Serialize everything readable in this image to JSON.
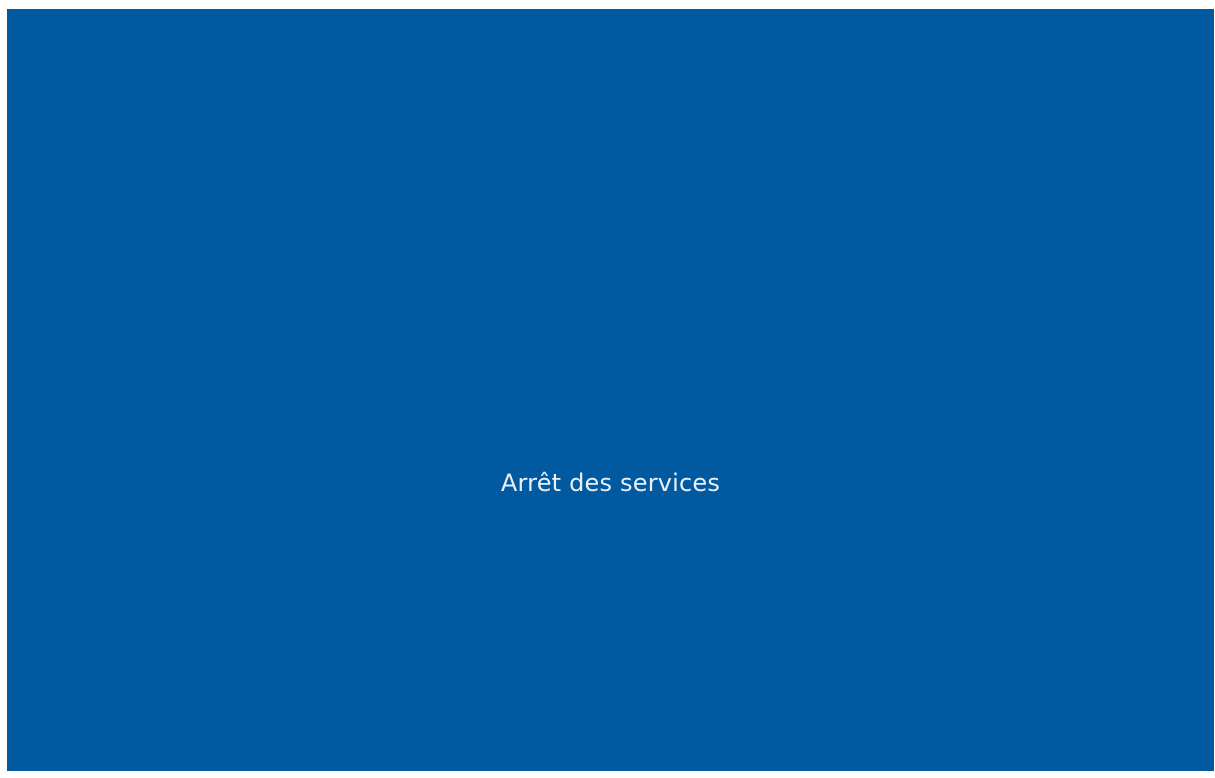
{
  "screen": {
    "status_message": "Arrêt des services",
    "background_color": "#015aa0",
    "text_color": "#e8eff7"
  }
}
